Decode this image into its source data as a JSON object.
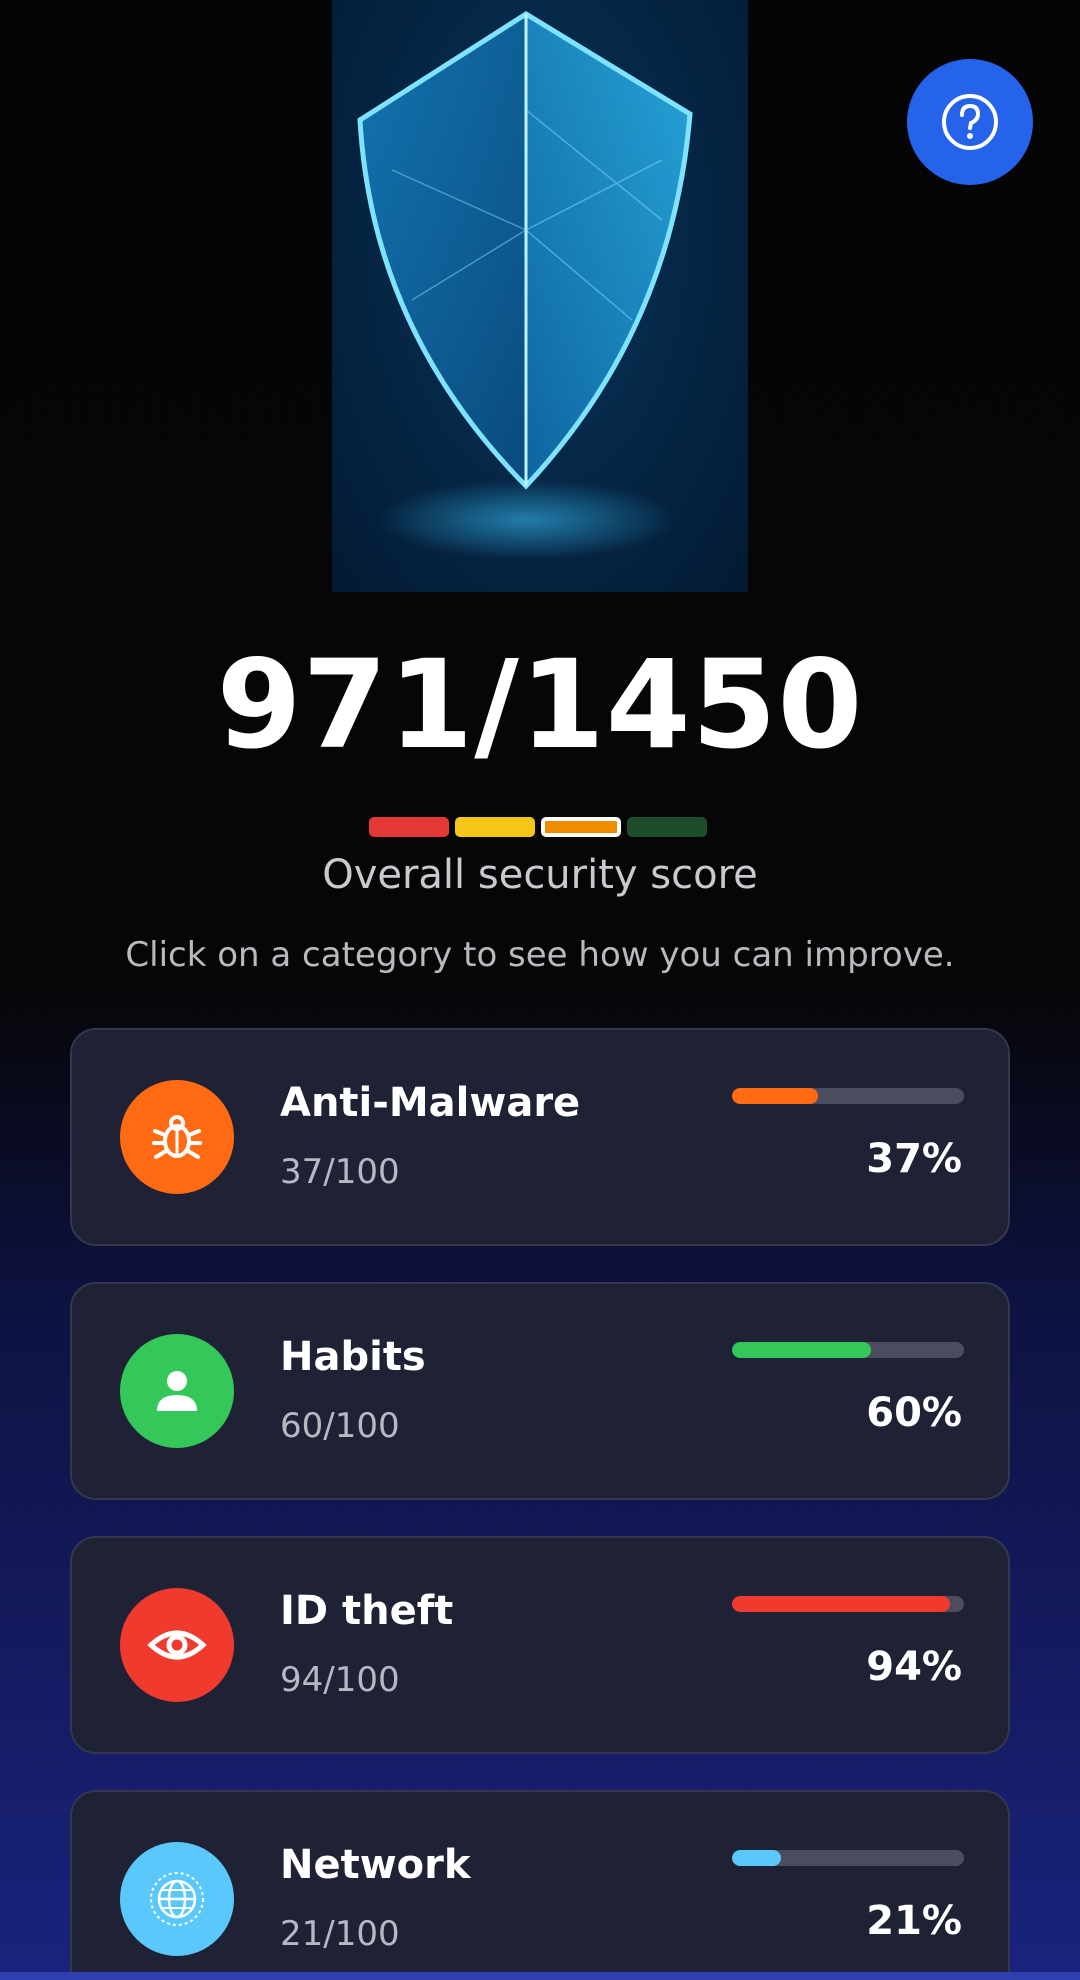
{
  "header": {
    "hero_image": "shield-graphic",
    "help_icon": "question-circle-icon"
  },
  "score": {
    "value": "971/1450",
    "label": "Overall security score",
    "segment_colors": [
      "#e53935",
      "#f5c518",
      "#f08c00",
      "#1e4d2b"
    ],
    "instruction": "Click on a category to see how you can improve."
  },
  "categories": [
    {
      "title": "Anti-Malware",
      "score": "37/100",
      "percent_label": "37%",
      "percent": 37,
      "color": "#ff6a13",
      "icon": "bug-icon"
    },
    {
      "title": "Habits",
      "score": "60/100",
      "percent_label": "60%",
      "percent": 60,
      "color": "#34c759",
      "icon": "user-icon"
    },
    {
      "title": "ID theft",
      "score": "94/100",
      "percent_label": "94%",
      "percent": 94,
      "color": "#f03a2e",
      "icon": "eye-icon"
    },
    {
      "title": "Network",
      "score": "21/100",
      "percent_label": "21%",
      "percent": 21,
      "color": "#5ac8fa",
      "icon": "globe-icon"
    }
  ]
}
